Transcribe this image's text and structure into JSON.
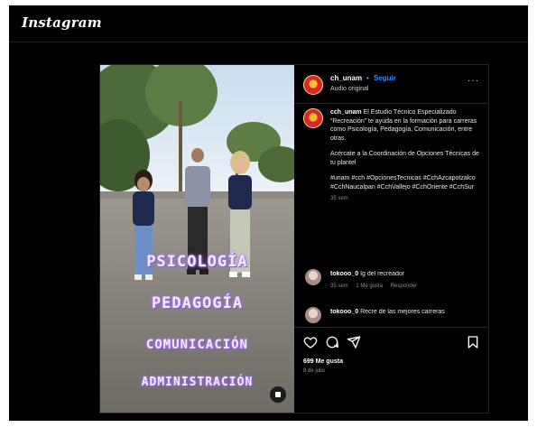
{
  "app": {
    "logo": "Instagram"
  },
  "post": {
    "username": "ch_unam",
    "separator": "•",
    "follow_label": "Seguir",
    "audio": "Audio original",
    "more_glyph": "···",
    "media_overlay": [
      "PSICOLOGÍA",
      "PEDAGOGÍA",
      "COMUNICACIÓN",
      "ADMINISTRACIÓN"
    ],
    "caption": {
      "username": "cch_unam",
      "text": "El Estudio Técnico Especializado “Recreación” te ayuda en la formación para carreras como Psicología, Pedagogía, Comunicación, entre otras.",
      "text2": "Acércate a la Coordinación de Opciones Técnicas de tu plantel",
      "hashtags": "#unam #cch #OpcionesTecnicas #CchAzcapotzalco #CchNaucalpan #CchVallejo #CchOriente #CchSur",
      "time": "35 sem"
    },
    "comments": [
      {
        "username": "tokooo_0",
        "text": "Ig del recreador",
        "time": "35 sem",
        "likes": "1 Me gusta",
        "reply": "Responder"
      },
      {
        "username": "tokooo_0",
        "text": "Recre de las mejores carreras"
      }
    ],
    "likes": "699 Me gusta",
    "date": "8 de julio"
  },
  "icons": {
    "heart": "heart-icon",
    "comment": "comment-icon",
    "share": "share-icon",
    "save": "bookmark-icon",
    "audio": "audio-mute-icon",
    "more": "more-options-icon"
  },
  "colors": {
    "follow": "#2d8cff",
    "background": "#000000",
    "avatar_red": "#d8262e",
    "avatar_gold": "#f6c02a"
  }
}
